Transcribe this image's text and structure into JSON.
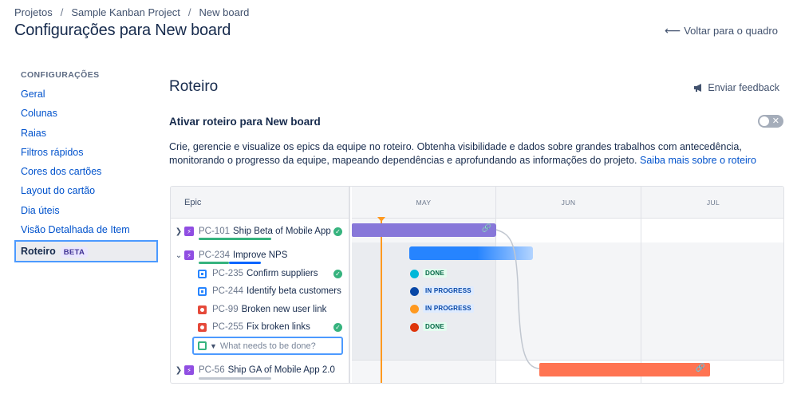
{
  "breadcrumb": [
    "Projetos",
    "Sample Kanban Project",
    "New board"
  ],
  "page_title": "Configurações para New board",
  "back_link": "Voltar para o quadro",
  "sidebar": {
    "heading": "CONFIGURAÇÕES",
    "items": [
      {
        "label": "Geral"
      },
      {
        "label": "Colunas"
      },
      {
        "label": "Raias"
      },
      {
        "label": "Filtros rápidos"
      },
      {
        "label": "Cores dos cartões"
      },
      {
        "label": "Layout do cartão"
      },
      {
        "label": "Dia úteis"
      },
      {
        "label": "Visão Detalhada de Item"
      },
      {
        "label": "Roteiro",
        "badge": "BETA",
        "active": true
      }
    ]
  },
  "section": {
    "title": "Roteiro",
    "feedback": "Enviar feedback",
    "enable_label": "Ativar roteiro para New board",
    "toggle_on": false,
    "description": "Crie, gerencie e visualize os epics da equipe no roteiro. Obtenha visibilidade e dados sobre grandes trabalhos com antecedência, monitorando o progresso da equipe, mapeando dependências e aprofundando as informações do projeto.",
    "learn_more": "Saiba mais sobre o roteiro"
  },
  "roadmap": {
    "epic_header": "Epic",
    "months": [
      "MAY",
      "JUN",
      "JUL"
    ],
    "rows": [
      {
        "key": "PC-101",
        "title": "Ship Beta of Mobile App",
        "kind": "epic",
        "expanded": false,
        "done": true,
        "progress_color": "#36b37e"
      },
      {
        "key": "PC-234",
        "title": "Improve NPS",
        "kind": "epic",
        "expanded": true,
        "done": false,
        "progress_color": "#36b37e"
      },
      {
        "key": "PC-235",
        "title": "Confirm suppliers",
        "kind": "story",
        "done": true,
        "status": "DONE"
      },
      {
        "key": "PC-244",
        "title": "Identify beta customers",
        "kind": "story",
        "done": false,
        "status": "IN PROGRESS"
      },
      {
        "key": "PC-99",
        "title": "Broken new user link",
        "kind": "bug",
        "done": false,
        "status": "IN PROGRESS"
      },
      {
        "key": "PC-255",
        "title": "Fix broken links",
        "kind": "bug",
        "done": true,
        "status": "DONE"
      },
      {
        "key": "PC-56",
        "title": "Ship GA of Mobile App 2.0",
        "kind": "epic",
        "expanded": false,
        "done": false,
        "progress_color": "#c1c7d0"
      }
    ],
    "new_item_placeholder": "What needs to be done?",
    "colors": {
      "purple_bar": "#8777d9",
      "blue_bar": "#2684ff",
      "orange_bar": "#ff7452",
      "today": "#ff991f",
      "done_bg": "#e3fcef",
      "done_fg": "#006644",
      "inprogress_bg": "#deebff",
      "inprogress_fg": "#0747a6"
    }
  }
}
